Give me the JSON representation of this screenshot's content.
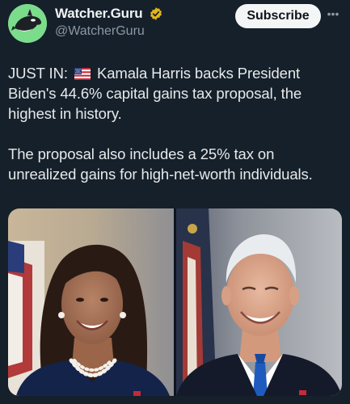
{
  "account": {
    "display_name": "Watcher.Guru",
    "handle": "@WatcherGuru",
    "avatar_icon": "orca-logo",
    "verified_icon": "gold-verified-badge-icon"
  },
  "actions": {
    "subscribe_label": "Subscribe",
    "more_label": "•••"
  },
  "tweet": {
    "prefix": "JUST IN:",
    "flag_icon": "us-flag-icon",
    "line1_rest": "Kamala Harris backs President Biden's 44.6% capital gains tax proposal, the highest in history.",
    "paragraph2": "The proposal also includes a 25% tax on unrealized gains for high-net-worth individuals."
  },
  "media": {
    "left_image": "kamala-harris-portrait",
    "right_image": "joe-biden-portrait"
  },
  "colors": {
    "background": "#15202b",
    "text": "#e7e9ea",
    "secondary_text": "#8b98a5",
    "avatar_green": "#7bdc8b",
    "verified_gold": "#e2b719",
    "button_bg": "#f4f5f6"
  }
}
